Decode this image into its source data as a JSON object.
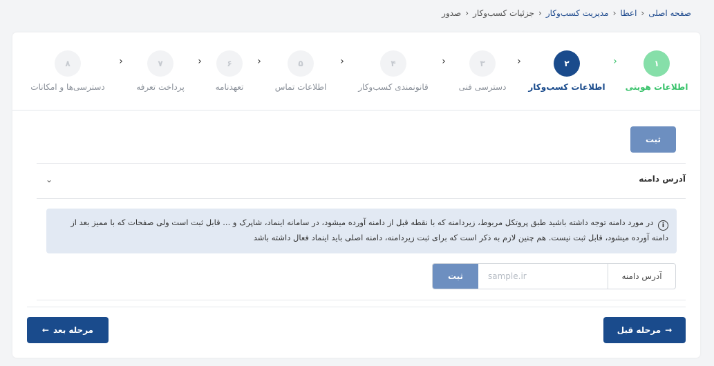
{
  "breadcrumb": {
    "items": [
      "صفحه اصلی",
      "اعطا",
      "مدیریت کسب‌وکار",
      "جزئیات کسب‌وکار",
      "صدور"
    ],
    "separator": "‹"
  },
  "steps": [
    {
      "number": "۱",
      "label": "اطلاعات هویتی",
      "state": "done"
    },
    {
      "number": "۲",
      "label": "اطلاعات کسب‌وکار",
      "state": "active"
    },
    {
      "number": "۳",
      "label": "دسترسی فنی",
      "state": "pending"
    },
    {
      "number": "۴",
      "label": "قانونمندی کسب‌وکار",
      "state": "pending"
    },
    {
      "number": "۵",
      "label": "اطلاعات تماس",
      "state": "pending"
    },
    {
      "number": "۶",
      "label": "تعهدنامه",
      "state": "pending"
    },
    {
      "number": "۷",
      "label": "پرداخت تعرفه",
      "state": "pending"
    },
    {
      "number": "۸",
      "label": "دسترسی‌ها و امکانات",
      "state": "pending"
    }
  ],
  "step_chevron": "‹",
  "form": {
    "submit_label": "ثبت",
    "section_title": "آدرس دامنه",
    "section_chevron": "⌄",
    "info_icon": "i",
    "info_text": "در مورد دامنه توجه داشته باشید طبق پروتکل مربوط، زیردامنه که با نقطه قبل از دامنه آورده میشود، در سامانه اینماد، شاپرک و ... قابل ثبت است ولی صفحات که با ممیز بعد از دامنه آورده میشود، قابل ثبت نیست. هم چنین لازم به ذکر است که برای ثبت زیردامنه، دامنه اصلی باید اینماد فعال داشته باشد",
    "domain_label": "آدرس دامنه",
    "domain_placeholder": "sample.ir",
    "domain_value": "",
    "domain_submit_label": "ثبت"
  },
  "footer": {
    "prev_label": "مرحله قبل",
    "prev_arrow": "→",
    "next_label": "مرحله بعد",
    "next_arrow": "←"
  },
  "colors": {
    "primary": "#1a4b8c",
    "success": "#37c26a",
    "muted_button": "#6d8fc0",
    "info_bg": "#e2e9f3"
  }
}
